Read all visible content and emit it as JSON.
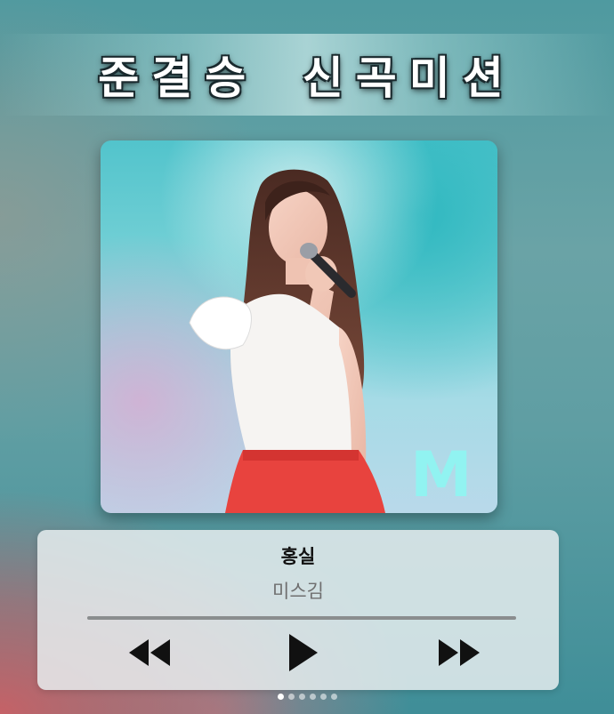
{
  "header": {
    "title": "준결승  신곡미션"
  },
  "album": {
    "watermark": "M"
  },
  "player": {
    "song_title": "홍실",
    "artist": "미스김",
    "progress": 0,
    "controls": {
      "prev_icon": "rewind-icon",
      "play_icon": "play-icon",
      "next_icon": "fast-forward-icon"
    }
  },
  "pagination": {
    "total": 6,
    "active": 1
  },
  "colors": {
    "track": "#8a8d8e",
    "card": "#e8eef0",
    "skirt": "#e8433e"
  }
}
